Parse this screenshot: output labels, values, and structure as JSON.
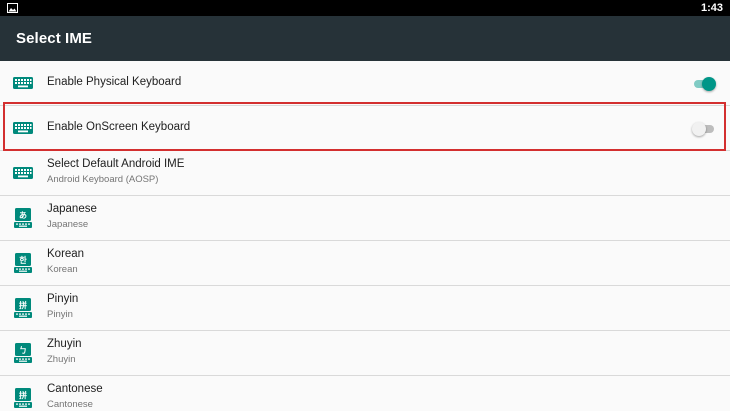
{
  "status_bar": {
    "time": "1:43",
    "notification_icon": "image-icon"
  },
  "app_bar": {
    "title": "Select IME"
  },
  "colors": {
    "app_bar": "#263238",
    "accent": "#009688",
    "icon": "#00897b",
    "highlight": "#d32f2f"
  },
  "items": [
    {
      "label": "Enable Physical Keyboard",
      "icon": "keyboard-icon",
      "toggle": true
    },
    {
      "label": "Enable OnScreen Keyboard",
      "icon": "keyboard-icon",
      "toggle": false
    },
    {
      "label": "Select Default Android IME",
      "sub": "Android Keyboard (AOSP)",
      "icon": "keyboard-icon"
    },
    {
      "label": "Japanese",
      "sub": "Japanese",
      "icon": "japanese-ime-icon",
      "glyph": "あ"
    },
    {
      "label": "Korean",
      "sub": "Korean",
      "icon": "korean-ime-icon",
      "glyph": "한"
    },
    {
      "label": "Pinyin",
      "sub": "Pinyin",
      "icon": "pinyin-ime-icon",
      "glyph": "拼"
    },
    {
      "label": "Zhuyin",
      "sub": "Zhuyin",
      "icon": "zhuyin-ime-icon",
      "glyph": "ㄅ"
    },
    {
      "label": "Cantonese",
      "sub": "Cantonese",
      "icon": "cantonese-ime-icon",
      "glyph": "拼"
    }
  ]
}
